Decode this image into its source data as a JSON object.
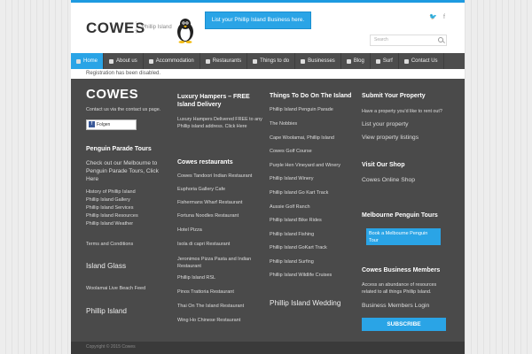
{
  "header": {
    "logo": "COWES",
    "tagline": "Phillip Island",
    "list_button": "List your Phillip Island Business here.",
    "social": [
      "twitter-icon",
      "facebook-icon"
    ],
    "search_placeholder": "Search"
  },
  "nav": {
    "items": [
      {
        "label": "Home",
        "icon": "home-icon"
      },
      {
        "label": "About us",
        "icon": "info-icon"
      },
      {
        "label": "Accommodation",
        "icon": "bed-icon"
      },
      {
        "label": "Restaurants",
        "icon": "cutlery-icon"
      },
      {
        "label": "Things to do",
        "icon": "grid-icon"
      },
      {
        "label": "Businesses",
        "icon": "grid-icon"
      },
      {
        "label": "Blog",
        "icon": "doc-icon"
      },
      {
        "label": "Surf",
        "icon": "plane-icon"
      },
      {
        "label": "Contact Us",
        "icon": "contact-icon"
      }
    ]
  },
  "notice": "Registration has been disabled.",
  "footer": {
    "col1": {
      "logo": "COWES",
      "contact_text": "Contact us via the contact us page.",
      "fb_label": "Folgen",
      "penguin_heading": "Penguin Parade Tours",
      "penguin_text": "Check out our Melbourne to Penguin Parade Tours, Click Here",
      "links": [
        "History of Phillip Island",
        "Phillip Island Gallery",
        "Phillip Island Services",
        "Phillip Island Resources",
        "Phillip Island Weather"
      ],
      "terms": "Terms and Conditions",
      "island_glass": "Island Glass",
      "woolamai": "Woolamai Live Beach Feed",
      "phillip_island": "Phillip Island"
    },
    "col2": {
      "hampers_heading": "Luxury Hampers – FREE Island Delivery",
      "hampers_text": "Luxury Hampers Delivered FREE to any Phillip island address. Click Here",
      "restaurants_heading": "Cowes restaurants",
      "restaurants": [
        "Cowes Tandoori Indian Restaurant",
        "Euphoria Gallery Cafe",
        "Fishermans Wharf Restaurant",
        "Fortuna Noodles Restaurant",
        "Hotel Pizza",
        "Isola di capri Restaurant",
        "Jeronimos Pizza Pasta and Indian Restaurant",
        "Phillip Island RSL",
        "Pinos Trattoria Restaurant",
        "Thai On The Island Restaurant",
        "Wing Ho Chinese Restaurant"
      ]
    },
    "col3": {
      "heading": "Things To Do On The Island",
      "items": [
        "Phillip Island Penguin Parade",
        "The Nobbies",
        "Cape Woolamai, Phillip Island",
        "Cowes Golf Course",
        "Purple Hen Vineyard and Winery",
        "Phillip Island Winery",
        "Phillip Island Go Kart Track",
        "Aussie Golf Ranch",
        "Phillip Island Bike Rides",
        "Phillip Island Fishing",
        "Phillip Island GoKart Track",
        "Phillip Island Surfing",
        "Phillip Island Wildlife Cruises"
      ],
      "wedding": "Phillip Island Wedding"
    },
    "col4": {
      "submit_heading": "Submit Your Property",
      "submit_text": "Have a property you'd like to rent out?",
      "list_property": "List your property",
      "view_listings": "View property listings",
      "shop_heading": "Visit Our Shop",
      "shop_link": "Cowes Online Shop",
      "tours_heading": "Melbourne Penguin Tours",
      "book_button": "Book a Melbourne Penguin Tour",
      "members_heading": "Cowes Business Members",
      "members_text": "Access an abundance of resources related to all things Phillip Island.",
      "members_login": "Business Members Login",
      "subscribe": "SUBSCRIBE"
    }
  },
  "copyright": "Copyright © 2015 Cowes",
  "colors": {
    "accent": "#2aa4e6",
    "footer_bg": "#4a4a4a",
    "nav_bg": "#4d4d4d"
  }
}
